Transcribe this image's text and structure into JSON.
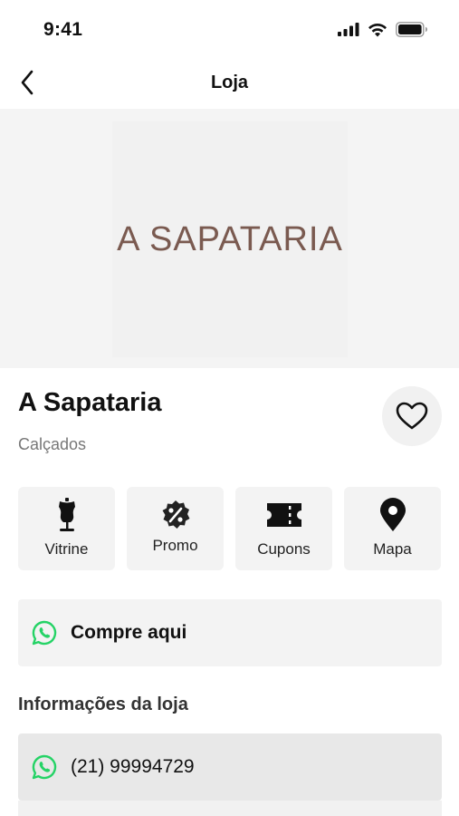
{
  "status_bar": {
    "time": "9:41"
  },
  "nav": {
    "title": "Loja"
  },
  "banner": {
    "logo_text": "A SAPATARIA"
  },
  "store": {
    "name": "A Sapataria",
    "category": "Calçados"
  },
  "actions": [
    {
      "label": "Vitrine",
      "icon": "mannequin-icon"
    },
    {
      "label": "Promo",
      "icon": "discount-badge-icon"
    },
    {
      "label": "Cupons",
      "icon": "ticket-icon"
    },
    {
      "label": "Mapa",
      "icon": "map-pin-icon"
    }
  ],
  "buy": {
    "label": "Compre aqui",
    "icon": "whatsapp-icon"
  },
  "info": {
    "title": "Informações da loja",
    "phone": "(21) 99994729",
    "phone_icon": "whatsapp-icon"
  },
  "colors": {
    "whatsapp": "#25D366",
    "brand_logo": "#7a5a50",
    "tile_bg": "#f3f3f3"
  }
}
